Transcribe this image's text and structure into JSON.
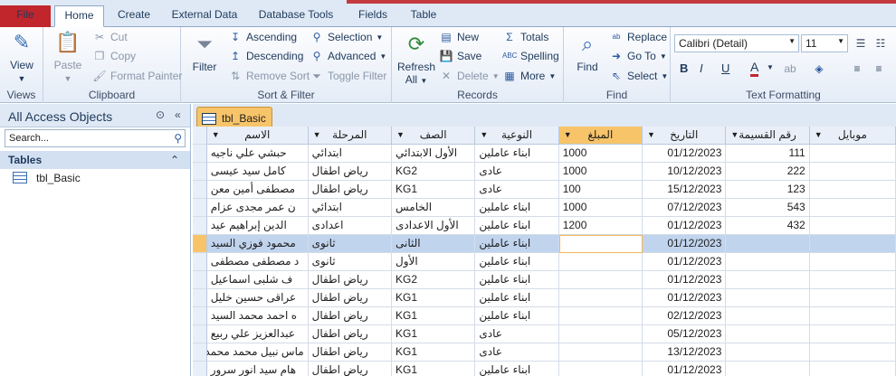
{
  "tabs": [
    "File",
    "Home",
    "Create",
    "External Data",
    "Database Tools",
    "Fields",
    "Table"
  ],
  "ribbon": {
    "views": {
      "view_label": "View",
      "group": "Views"
    },
    "clipboard": {
      "paste": "Paste",
      "cut": "Cut",
      "copy": "Copy",
      "format_painter": "Format Painter",
      "group": "Clipboard"
    },
    "sort_filter": {
      "filter": "Filter",
      "ascending": "Ascending",
      "descending": "Descending",
      "remove_sort": "Remove Sort",
      "selection": "Selection",
      "advanced": "Advanced",
      "toggle_filter": "Toggle Filter",
      "group": "Sort & Filter"
    },
    "records": {
      "refresh": "Refresh",
      "refresh_sub": "All",
      "new": "New",
      "save": "Save",
      "delete": "Delete",
      "totals": "Totals",
      "spelling": "Spelling",
      "more": "More",
      "group": "Records"
    },
    "find": {
      "find": "Find",
      "replace": "Replace",
      "goto": "Go To",
      "select": "Select",
      "group": "Find"
    },
    "text_formatting": {
      "font": "Calibri (Detail)",
      "size": "11",
      "bold": "B",
      "italic": "I",
      "underline": "U",
      "font_color": "A",
      "group": "Text Formatting"
    }
  },
  "nav": {
    "title": "All Access Objects",
    "search_placeholder": "Search...",
    "section": "Tables",
    "items": [
      "tbl_Basic"
    ]
  },
  "document": {
    "tab_label": "tbl_Basic",
    "columns": [
      "الاسم",
      "المرحلة",
      "الصف",
      "النوعية",
      "المبلغ",
      "التاريخ",
      "رقم القسيمة",
      "موبايل"
    ],
    "rows": [
      [
        "حبشي علي ناجيه",
        "ابتدائي",
        "الأول الابتدائي",
        "ابناء عاملين",
        "1000",
        "01/12/2023",
        "111",
        ""
      ],
      [
        "كامل سيد عيسى",
        "رياض اطفال",
        "KG2",
        "عادى",
        "1000",
        "10/12/2023",
        "222",
        ""
      ],
      [
        "مصطفى أمين معن",
        "رياض اطفال",
        "KG1",
        "عادى",
        "100",
        "15/12/2023",
        "123",
        ""
      ],
      [
        "ن عمر مجدى عزام",
        "ابتدائي",
        "الخامس",
        "ابناء عاملين",
        "1000",
        "07/12/2023",
        "543",
        ""
      ],
      [
        "الدين إبراهيم عيد",
        "اعدادى",
        "الأول الاعدادى",
        "ابناء عاملين",
        "1200",
        "01/12/2023",
        "432",
        ""
      ],
      [
        "محمود فوزي السيد",
        "ثانوى",
        "الثانى",
        "ابناء عاملين",
        "",
        "01/12/2023",
        "",
        ""
      ],
      [
        "د مصطفى مصطفى",
        "ثانوى",
        "الأول",
        "ابناء عاملين",
        "",
        "01/12/2023",
        "",
        ""
      ],
      [
        "ف شلبى اسماعيل",
        "رياض اطفال",
        "KG2",
        "ابناء عاملين",
        "",
        "01/12/2023",
        "",
        ""
      ],
      [
        "عراقى حسين خليل",
        "رياض اطفال",
        "KG1",
        "ابناء عاملين",
        "",
        "01/12/2023",
        "",
        ""
      ],
      [
        "ه احمد محمد السيد",
        "رياض اطفال",
        "KG1",
        "ابناء عاملين",
        "",
        "02/12/2023",
        "",
        ""
      ],
      [
        "عبدالعزيز علي ربيع",
        "رياض اطفال",
        "KG1",
        "عادى",
        "",
        "05/12/2023",
        "",
        ""
      ],
      [
        "ماس نبيل محمد محمد",
        "رياض اطفال",
        "KG1",
        "عادى",
        "",
        "13/12/2023",
        "",
        ""
      ],
      [
        "هام سيد انور سرور",
        "رياض اطفال",
        "KG1",
        "ابناء عاملين",
        "",
        "01/12/2023",
        "",
        ""
      ]
    ],
    "selected_row": 5
  }
}
